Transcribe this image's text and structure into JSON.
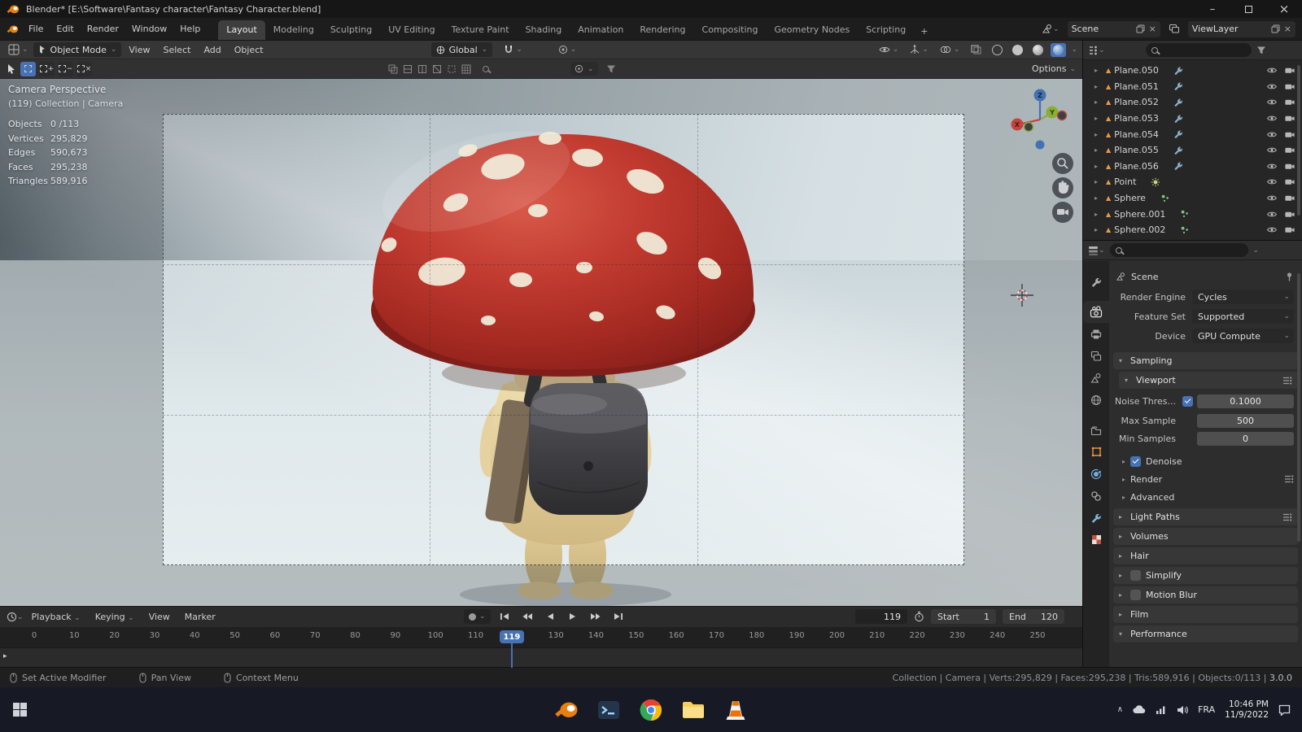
{
  "icons": {
    "chevron_down": "⌄",
    "collapse_right": "▸",
    "collapse_down": "▾",
    "mesh": "▲",
    "close": "×",
    "minimize": "–",
    "tray_chevron": "∧"
  },
  "titlebar": {
    "title": "Blender* [E:\\Software\\Fantasy character\\Fantasy Character.blend]"
  },
  "menubar": {
    "menus": [
      "File",
      "Edit",
      "Render",
      "Window",
      "Help"
    ],
    "workspaces": [
      "Layout",
      "Modeling",
      "Sculpting",
      "UV Editing",
      "Texture Paint",
      "Shading",
      "Animation",
      "Rendering",
      "Compositing",
      "Geometry Nodes",
      "Scripting"
    ],
    "add_workspace": "+",
    "scene_name": "Scene",
    "view_layer_name": "ViewLayer"
  },
  "viewport_header": {
    "mode": "Object Mode",
    "menus": [
      "View",
      "Select",
      "Add",
      "Object"
    ],
    "orientation": "Global"
  },
  "tool_settings": {
    "options_label": "Options"
  },
  "viewport": {
    "view_name": "Camera Perspective",
    "context_line": "(119) Collection | Camera",
    "stats": [
      {
        "label": "Objects",
        "value": "0 /113"
      },
      {
        "label": "Vertices",
        "value": "295,829"
      },
      {
        "label": "Edges",
        "value": "590,673"
      },
      {
        "label": "Faces",
        "value": "295,238"
      },
      {
        "label": "Triangles",
        "value": "589,916"
      }
    ],
    "axis_labels": {
      "x": "X",
      "y": "Y",
      "z": "Z"
    }
  },
  "outliner": {
    "items": [
      {
        "name": "Plane.050",
        "extra": "modifier"
      },
      {
        "name": "Plane.051",
        "extra": "modifier"
      },
      {
        "name": "Plane.052",
        "extra": "modifier"
      },
      {
        "name": "Plane.053",
        "extra": "modifier"
      },
      {
        "name": "Plane.054",
        "extra": "modifier"
      },
      {
        "name": "Plane.055",
        "extra": "modifier"
      },
      {
        "name": "Plane.056",
        "extra": "modifier"
      },
      {
        "name": "Point",
        "extra": "light"
      },
      {
        "name": "Sphere",
        "extra": "particles"
      },
      {
        "name": "Sphere.001",
        "extra": "particles"
      },
      {
        "name": "Sphere.002",
        "extra": "particles"
      }
    ]
  },
  "properties": {
    "breadcrumb": "Scene",
    "render_engine_label": "Render Engine",
    "render_engine_value": "Cycles",
    "feature_set_label": "Feature Set",
    "feature_set_value": "Supported",
    "device_label": "Device",
    "device_value": "GPU Compute",
    "sampling_title": "Sampling",
    "viewport_title": "Viewport",
    "noise_label": "Noise Thres...",
    "noise_value": "0.1000",
    "max_samples_label": "Max Sample",
    "max_samples_value": "500",
    "min_samples_label": "Min Samples",
    "min_samples_value": "0",
    "denoise_label": "Denoise",
    "render_subpanel": "Render",
    "advanced_subpanel": "Advanced",
    "sections": [
      "Light Paths",
      "Volumes",
      "Hair",
      "Simplify",
      "Motion Blur",
      "Film",
      "Performance"
    ]
  },
  "timeline": {
    "menus": [
      "Playback",
      "Keying",
      "View",
      "Marker"
    ],
    "ticks": [
      "0",
      "10",
      "20",
      "30",
      "40",
      "50",
      "60",
      "70",
      "80",
      "90",
      "100",
      "110",
      "130",
      "140",
      "150",
      "160",
      "170",
      "180",
      "190",
      "200",
      "210",
      "220",
      "230",
      "240",
      "250"
    ],
    "current_frame": "119",
    "frame_field_value": "119",
    "start_label": "Start",
    "start_value": "1",
    "end_label": "End",
    "end_value": "120"
  },
  "statusbar": {
    "hints": [
      {
        "icon": "mouse-left",
        "label": "Set Active Modifier"
      },
      {
        "icon": "mouse-middle",
        "label": "Pan View"
      },
      {
        "icon": "mouse-right",
        "label": "Context Menu"
      }
    ],
    "scene_stats": "Collection | Camera | Verts:295,829 | Faces:295,238 | Tris:589,916 | Objects:0/113 | ",
    "version": "3.0.0"
  },
  "taskbar": {
    "apps": [
      "blender",
      "terminal",
      "chrome",
      "file-explorer",
      "vlc"
    ],
    "language": "FRA",
    "time": "10:46 PM",
    "date": "11/9/2022"
  }
}
